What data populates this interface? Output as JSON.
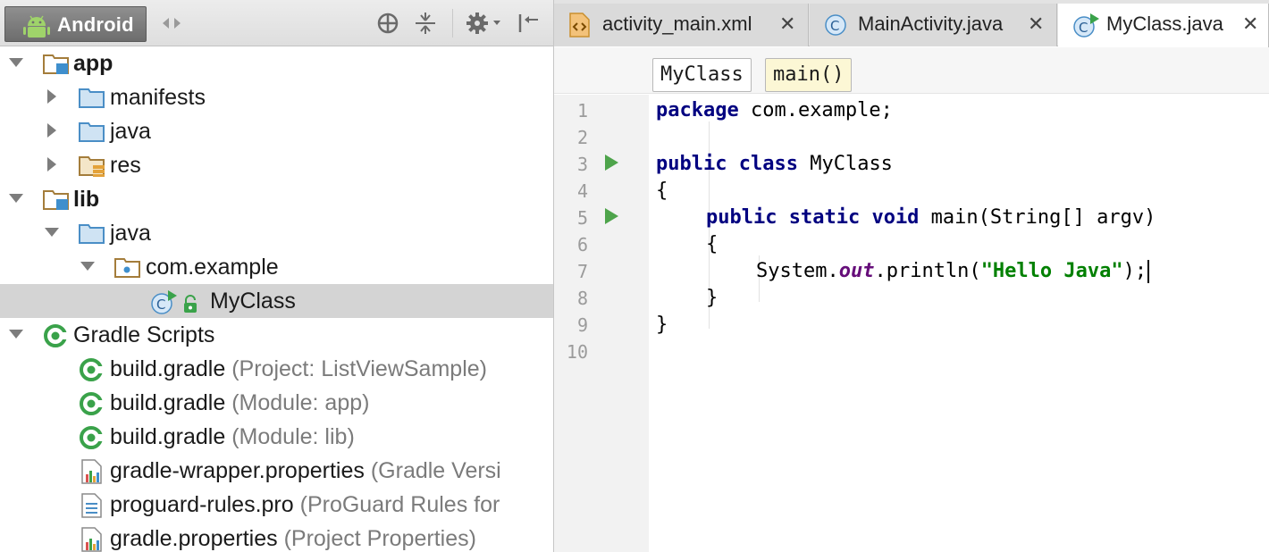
{
  "project_panel": {
    "view_selector_label": "Android",
    "tree": [
      {
        "label": "app",
        "bold": true,
        "hint": "",
        "icon": "module-folder-icon",
        "expanded": true
      },
      {
        "label": "manifests",
        "bold": false,
        "hint": "",
        "icon": "folder-icon",
        "expanded": false
      },
      {
        "label": "java",
        "bold": false,
        "hint": "",
        "icon": "folder-icon",
        "expanded": false
      },
      {
        "label": "res",
        "bold": false,
        "hint": "",
        "icon": "res-folder-icon",
        "expanded": false
      },
      {
        "label": "lib",
        "bold": true,
        "hint": "",
        "icon": "module-folder-icon",
        "expanded": true
      },
      {
        "label": "java",
        "bold": false,
        "hint": "",
        "icon": "folder-icon",
        "expanded": true
      },
      {
        "label": "com.example",
        "bold": false,
        "hint": "",
        "icon": "package-icon",
        "expanded": true
      },
      {
        "label": "MyClass",
        "bold": false,
        "hint": "",
        "icon": "class-icon",
        "selected": true
      },
      {
        "label": "Gradle Scripts",
        "bold": false,
        "hint": "",
        "icon": "gradle-icon",
        "expanded": true
      },
      {
        "label": "build.gradle",
        "bold": false,
        "hint": "(Project: ListViewSample)",
        "icon": "gradle-icon"
      },
      {
        "label": "build.gradle",
        "bold": false,
        "hint": "(Module: app)",
        "icon": "gradle-icon"
      },
      {
        "label": "build.gradle",
        "bold": false,
        "hint": "(Module: lib)",
        "icon": "gradle-icon"
      },
      {
        "label": "gradle-wrapper.properties",
        "bold": false,
        "hint": "(Gradle Versi",
        "icon": "properties-file-icon"
      },
      {
        "label": "proguard-rules.pro",
        "bold": false,
        "hint": "(ProGuard Rules for",
        "icon": "text-file-icon"
      },
      {
        "label": "gradle.properties",
        "bold": false,
        "hint": "(Project Properties)",
        "icon": "properties-file-icon"
      }
    ]
  },
  "editor": {
    "tabs": [
      {
        "title": "activity_main.xml",
        "icon": "xml-file-icon",
        "active": false
      },
      {
        "title": "MainActivity.java",
        "icon": "class-icon",
        "active": false
      },
      {
        "title": "MyClass.java",
        "icon": "class-run-icon",
        "active": true
      }
    ],
    "close_glyph": "✕",
    "breadcrumbs": [
      "MyClass",
      "main()"
    ],
    "line_numbers": [
      "1",
      "2",
      "3",
      "4",
      "5",
      "6",
      "7",
      "8",
      "9",
      "10"
    ],
    "current_line": 7,
    "code": {
      "kw_package": "package",
      "pkg_name": " com.example;",
      "kw_public1": "public",
      "kw_class": " class",
      "class_name": " MyClass",
      "brace_open1": "{",
      "kw_public2": "public",
      "kw_static": " static",
      "kw_void": " void",
      "method_sig": " main(String[] argv)",
      "brace_open2": "{",
      "sys": "System.",
      "out": "out",
      "println": ".println(",
      "str": "\"Hello Java\"",
      "end": ");",
      "brace_close2": "}",
      "brace_close1": "}"
    }
  },
  "colors": {
    "keyword": "#000080",
    "string": "#008000",
    "field": "#660e7a",
    "run_marker": "#4ea44b",
    "selection": "#d4d4d4",
    "current_line": "#fdf8e2"
  }
}
